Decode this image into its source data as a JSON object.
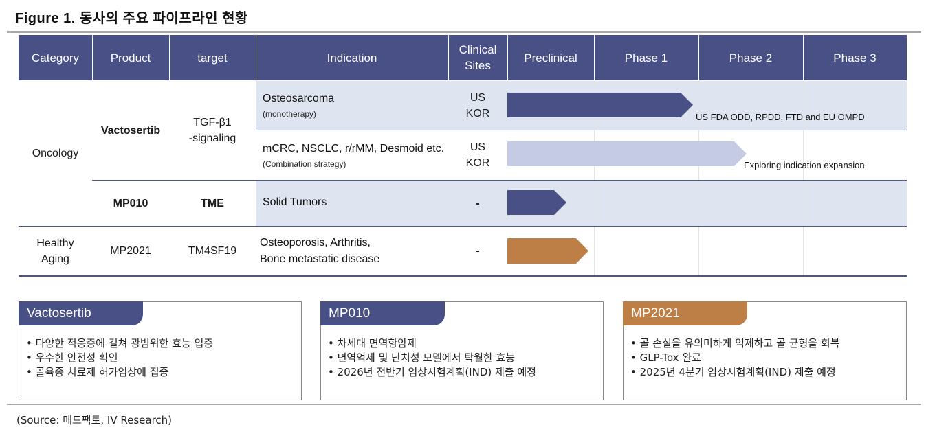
{
  "title": "Figure 1. 동사의 주요 파이프라인 현황",
  "headers": {
    "category": "Category",
    "product": "Product",
    "target": "target",
    "indication": "Indication",
    "sites_line1": "Clinical",
    "sites_line2": "Sites",
    "preclinical": "Preclinical",
    "phase1": "Phase 1",
    "phase2": "Phase 2",
    "phase3": "Phase 3"
  },
  "rows": {
    "oncology_category": "Oncology",
    "vactosertib_product": "Vactosertib",
    "vactosertib_target_line1": "TGF-β1",
    "vactosertib_target_line2": "-signaling",
    "r1": {
      "indication": "Osteosarcoma",
      "sub": "(monotherapy)",
      "sites_line1": "US",
      "sites_line2": "KOR",
      "note": "US FDA ODD, RPDD, FTD  and EU OMPD"
    },
    "r2": {
      "indication": "mCRC, NSCLC, r/rMM, Desmoid etc.",
      "sub": "(Combination strategy)",
      "sites_line1": "US",
      "sites_line2": "KOR",
      "note": "Exploring indication expansion"
    },
    "r3": {
      "product": "MP010",
      "target": "TME",
      "indication": "Solid Tumors",
      "sites": "-"
    },
    "r4": {
      "category_line1": "Healthy",
      "category_line2": "Aging",
      "product": "MP2021",
      "target": "TM4SF19",
      "indication_line1": "Osteoporosis, Arthritis,",
      "indication_line2": "Bone metastatic disease",
      "sites": "-"
    }
  },
  "boxes": {
    "vactosertib": {
      "title": "Vactosertib",
      "items": [
        "• 다양한 적응증에 걸쳐 광범위한 효능 입증",
        "• 우수한 안전성 확인",
        "• 골육종 치료제 허가임상에 집중"
      ]
    },
    "mp010": {
      "title": "MP010",
      "items": [
        "• 차세대 면역항암제",
        "• 면역억제 및 난치성 모델에서 탁월한 효능",
        "• 2026년 전반기 임상시험계획(IND) 제출 예정"
      ]
    },
    "mp2021": {
      "title": "MP2021",
      "items": [
        "• 골 손실을 유의미하게 억제하고 골 균형을 회복",
        "• GLP-Tox 완료",
        "• 2025년 4분기 임상시험계획(IND) 제출 예정"
      ]
    }
  },
  "source": "(Source: 메드팩토, IV Research)",
  "colors": {
    "header": "#485086",
    "band": "#dfe4f1",
    "arrow_dark": "#485086",
    "arrow_light": "#c5cbe4",
    "arrow_orange": "#bd7f45"
  }
}
